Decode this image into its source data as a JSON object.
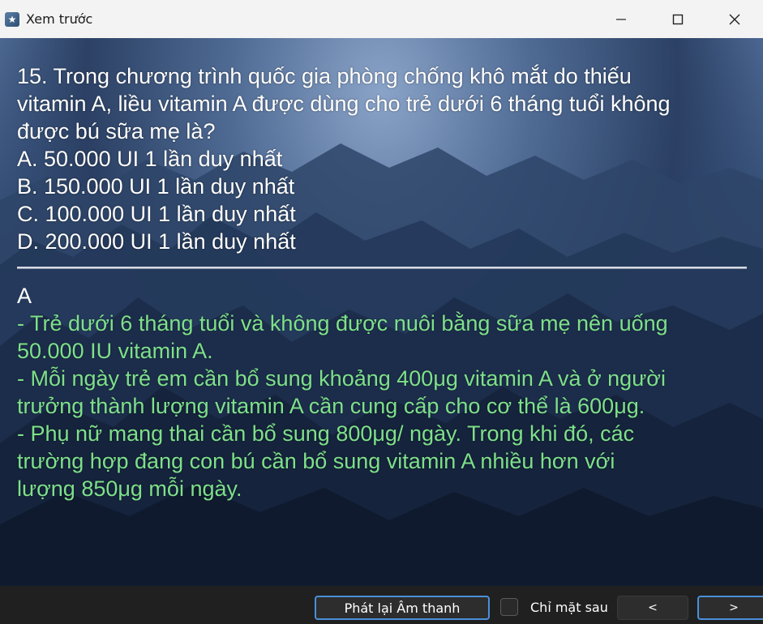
{
  "window": {
    "title": "Xem trước"
  },
  "question": {
    "lines": [
      "15. Trong chương trình quốc gia phòng chống khô mắt do thiếu",
      "vitamin A, liều vitamin A được dùng cho trẻ dưới 6 tháng tuổi không",
      "được bú sữa mẹ là?"
    ],
    "options": [
      "A. 50.000 UI 1 lần duy nhất",
      "B. 150.000 UI 1 lần duy nhất",
      "C. 100.000 UI 1 lần duy nhất",
      "D. 200.000 UI 1 lần duy nhất"
    ]
  },
  "answer": {
    "letter": "A",
    "explanation_lines": [
      "- Trẻ dưới 6 tháng tuổi và không được nuôi bằng sữa mẹ nên uống",
      "50.000 IU vitamin A.",
      "- Mỗi ngày trẻ em cần bổ sung khoảng 400μg vitamin A và ở người",
      "trưởng thành lượng vitamin A cần cung cấp cho cơ thể là 600μg.",
      "- Phụ nữ mang thai cần bổ sung 800μg/ ngày. Trong khi đó, các",
      "trường hợp đang con bú cần bổ sung vitamin A nhiều hơn với",
      "lượng 850μg mỗi ngày."
    ]
  },
  "controls": {
    "replay_label": "Phát lại Âm thanh",
    "back_only_label": "Chỉ mặt sau",
    "back_only_checked": false,
    "prev_label": "<",
    "next_label": ">"
  },
  "colors": {
    "explanation_text": "#7ee08a",
    "focus_border": "#4a8fd8"
  }
}
